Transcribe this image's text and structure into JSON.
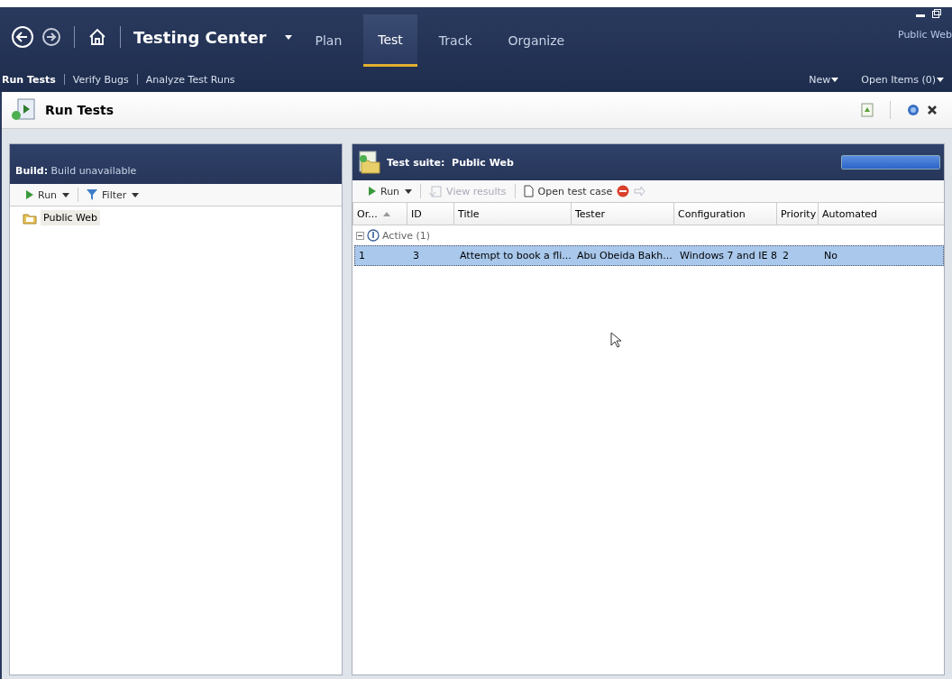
{
  "app": {
    "title": "Testing Center",
    "project": "Public Web"
  },
  "tabs": [
    {
      "label": "Plan",
      "selected": false
    },
    {
      "label": "Test",
      "selected": true
    },
    {
      "label": "Track",
      "selected": false
    },
    {
      "label": "Organize",
      "selected": false
    }
  ],
  "subnav": [
    {
      "label": "Run Tests",
      "selected": true
    },
    {
      "label": "Verify Bugs",
      "selected": false
    },
    {
      "label": "Analyze Test Runs",
      "selected": false
    }
  ],
  "subnav_actions": [
    {
      "label": "New"
    },
    {
      "label": "Open Items (0)"
    }
  ],
  "page": {
    "title": "Run Tests"
  },
  "left_pane": {
    "header_label": "Build:",
    "header_value": "Build unavailable",
    "toolbar": [
      {
        "kind": "run",
        "label": "Run"
      },
      {
        "kind": "filter",
        "label": "Filter"
      }
    ],
    "tree": [
      {
        "label": "Public Web",
        "selected": true
      }
    ]
  },
  "right_pane": {
    "header_label": "Test suite:",
    "header_value": "Public Web",
    "progress": {
      "level": 1
    },
    "toolbar": [
      {
        "kind": "run",
        "label": "Run",
        "disabled": false
      },
      {
        "kind": "results",
        "label": "View results",
        "disabled": true
      },
      {
        "kind": "open",
        "label": "Open test case",
        "disabled": false
      },
      {
        "kind": "stop",
        "disabled": false
      },
      {
        "kind": "forward",
        "disabled": true
      }
    ],
    "table": {
      "columns": [
        "Or...",
        "ID",
        "Title",
        "Tester",
        "Configuration",
        "Priority",
        "Automated"
      ],
      "groups": [
        {
          "label": "Active (1)",
          "expanded": true,
          "rows": [
            {
              "cells": [
                "1",
                "3",
                "Attempt to book a fli...",
                "Abu Obeida Bakh...",
                "Windows 7 and IE 8",
                "2",
                "No"
              ],
              "selected": true
            }
          ]
        }
      ]
    }
  }
}
